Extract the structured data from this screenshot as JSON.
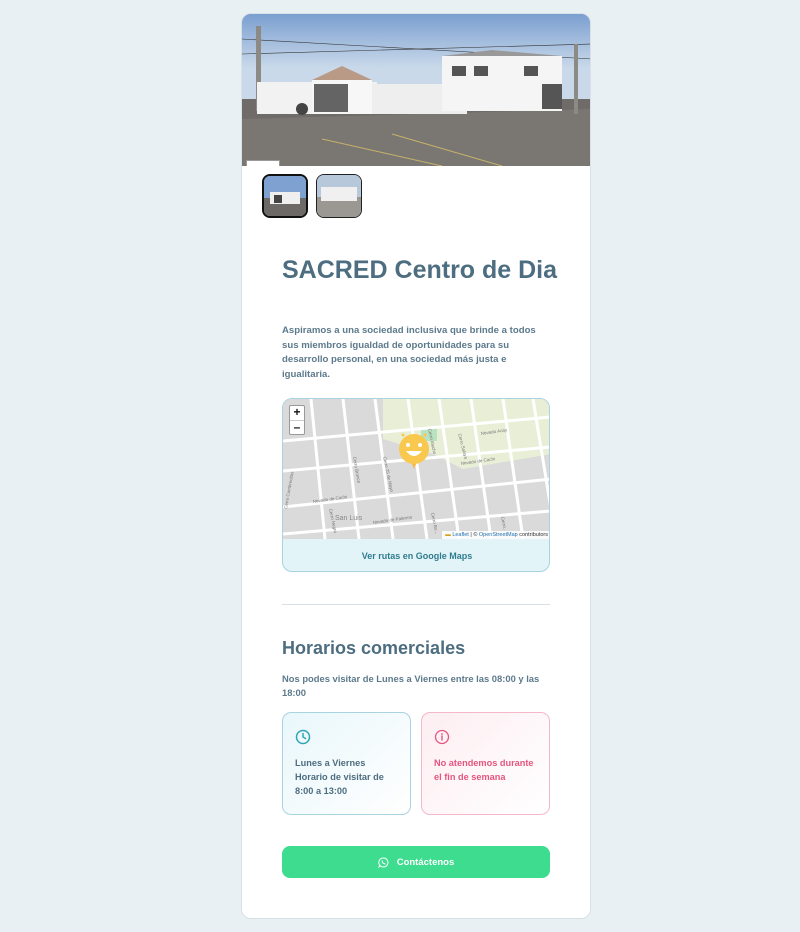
{
  "listing": {
    "title": "SACRED Centro de Dia",
    "description": "Aspiramos a una sociedad inclusiva que brinde a todos sus miembros igualdad de oportunidades para su desarrollo personal, en una sociedad más justa e igualitaria."
  },
  "gallery": {
    "thumbnails": [
      "street-view-1",
      "street-view-2"
    ],
    "active_index": 0
  },
  "map": {
    "zoom_in": "+",
    "zoom_out": "–",
    "streets": [
      "Cerro Morado",
      "Cerro Bronce",
      "Cerro 25 de Mayo",
      "Cerro Alecho",
      "Cerro Salaya",
      "Nevado Acay",
      "Nevado de Cachi",
      "Nevado de Cachi",
      "Cerro Cumbrecitas",
      "Cerro Negro",
      "Nevado de Palermo",
      "Cerro Bu...",
      "Cerro...",
      "Nevado de Cachi"
    ],
    "place": "San Luis",
    "attribution_leaflet": "Leaflet",
    "attribution_sep": " | © ",
    "attribution_osm": "OpenStreetMap",
    "attribution_tail": " contributors",
    "route_link": "Ver rutas en Google Maps"
  },
  "hours": {
    "heading": "Horarios comerciales",
    "text": "Nos podes visitar de Lunes a Viernes entre las 08:00 y las 18:00",
    "weekday_card": {
      "line1": "Lunes a Viernes",
      "line2": "Horario de visitar de",
      "line3": "8:00 a 13:00"
    },
    "weekend_card": {
      "line1": "No atendemos durante",
      "line2": "el fin de semana"
    }
  },
  "cta": {
    "label": "Contáctenos"
  },
  "colors": {
    "accent_teal": "#2fa6b8",
    "accent_pink": "#e5557f",
    "cta_green": "#3ddc8e",
    "heading": "#4d6d80"
  }
}
